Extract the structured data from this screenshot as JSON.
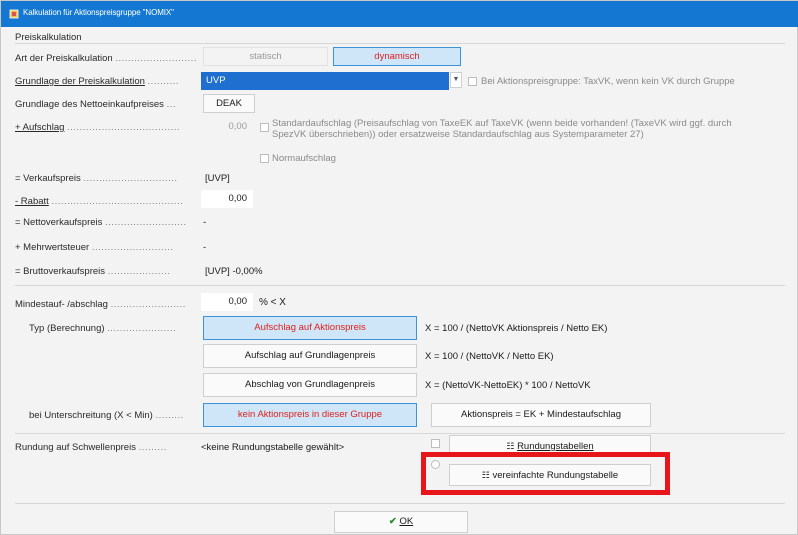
{
  "window": {
    "title": "Kalkulation für Aktionspreisgruppe \"NOMIX\""
  },
  "section": {
    "title": "Preiskalkulation"
  },
  "rows": {
    "art": {
      "label": "Art der Preiskalkulation",
      "dots": "..........................",
      "btn_static": "statisch",
      "btn_dynamic": "dynamisch"
    },
    "grundlage": {
      "label": "Grundlage der Preiskalkulation",
      "dots": "..........",
      "value": "UVP",
      "checkbox_label": "Bei Aktionspreisgruppe: TaxVK, wenn kein VK durch Gruppe"
    },
    "netto_ek": {
      "label": "Grundlage des Nettoeinkaufpreises",
      "dots": "...",
      "value": "DEAK"
    },
    "aufschlag": {
      "label": "+ Aufschlag",
      "dots": "....................................",
      "value": "0,00",
      "note_line1": "Standardaufschlag (Preisaufschlag von TaxeEK auf TaxeVK (wenn beide vorhanden! (TaxeVK wird ggf. durch",
      "note_line2": "SpezVK überschrieben)) oder ersatzweise Standardaufschlag aus Systemparameter 27)",
      "normaufschlag": "Normaufschlag"
    },
    "verkaufspreis": {
      "label": "= Verkaufspreis",
      "dots": "..............................",
      "value": "[UVP]"
    },
    "rabatt": {
      "label": "- Rabatt",
      "dots": "..........................................",
      "value": "0,00"
    },
    "nettoverkaufspreis": {
      "label": "= Nettoverkaufspreis",
      "dots": "..........................",
      "value": "-"
    },
    "mehrwertsteuer": {
      "label": "+ Mehrwertsteuer",
      "dots": "..........................",
      "value": "-"
    },
    "bruttoverkaufspreis": {
      "label": "= Bruttoverkaufspreis",
      "dots": "....................",
      "value": "[UVP] -0,00%"
    }
  },
  "mindest": {
    "label": "Mindestauf- /abschlag",
    "dots": "........................",
    "value": "0,00",
    "unit": "% < X",
    "typ_label": "Typ (Berechnung)",
    "typ_dots": "......................",
    "typ_options": [
      {
        "label": "Aufschlag auf Aktionspreis",
        "formula": "X = 100 / (NettoVK Aktionspreis / Netto EK)"
      },
      {
        "label": "Aufschlag auf Grundlagenpreis",
        "formula": "X = 100 / (NettoVK / Netto EK)"
      },
      {
        "label": "Abschlag von Grundlagenpreis",
        "formula": "X = (NettoVK-NettoEK) * 100 / NettoVK"
      }
    ],
    "unter_label": "bei Unterschreitung (X < Min)",
    "unter_dots": ".........",
    "unter_btn1": "kein Aktionspreis in dieser Gruppe",
    "unter_btn2": "Aktionspreis = EK + Mindestaufschlag"
  },
  "rundung": {
    "label": "Rundung auf Schwellenpreis",
    "dots": ".........",
    "value": "<keine Rundungstabelle gewählt>",
    "btn_tabellen": "Rundungstabellen",
    "btn_vereinfacht": "vereinfachte Rundungstabelle"
  },
  "footer": {
    "ok": "OK"
  },
  "colors": {
    "titlebar": "#1478d2",
    "selected_bg": "#cfe6f8",
    "selected_text": "#e0201c",
    "highlight": "#e8151b"
  }
}
